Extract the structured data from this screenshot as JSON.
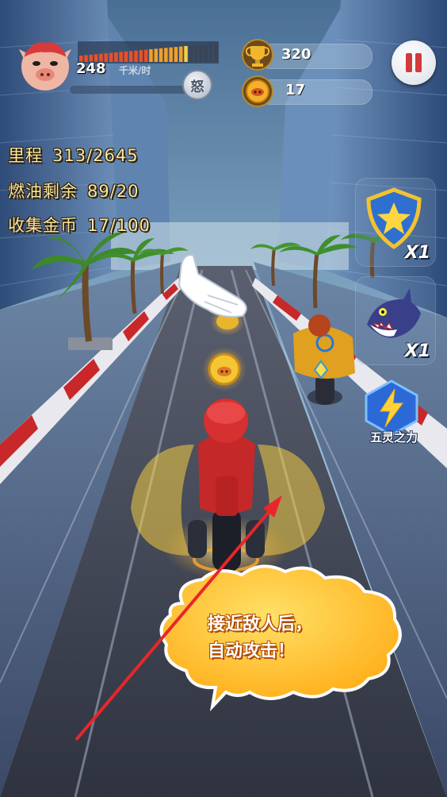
{
  "hud": {
    "speed_value": "248",
    "speed_unit": "千米/时",
    "speed_level": 0.8,
    "rage_button_label": "怒",
    "trophy_count": "320",
    "coin_count": "17"
  },
  "stats": {
    "distance_label": "里程",
    "distance_value": "313/2645",
    "fuel_label": "燃油剩余",
    "fuel_value": "89/20",
    "coins_label": "收集金币",
    "coins_value": "17/100"
  },
  "powerups": {
    "shield_count": "X1",
    "shark_count": "X1",
    "lightning_label": "五灵之力"
  },
  "tutorial": {
    "line1": "接近敌人后，",
    "line2": "自动攻击！"
  },
  "colors": {
    "stat_text": "#f7e9a0",
    "bubble": "#ffc62a",
    "arrow": "#e8262a",
    "road": "#3c4150",
    "curb_red": "#c8282a"
  },
  "icons": {
    "avatar": "pig-hero-avatar-icon",
    "trophy": "trophy-icon",
    "coin": "pig-coin-icon",
    "pause": "pause-icon",
    "shield": "star-shield-icon",
    "shark": "shark-icon",
    "lightning": "lightning-icon",
    "pointer": "pointing-hand-icon"
  }
}
